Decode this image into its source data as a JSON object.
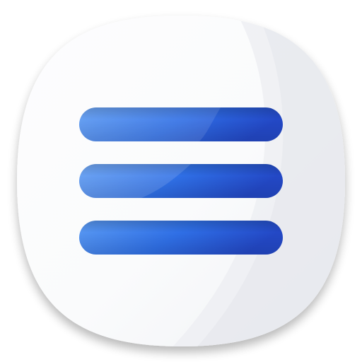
{
  "app_icon": {
    "icon_name": "hamburger-menu-icon",
    "bar_count": 3,
    "colors": {
      "tile_light": "#fdfdfe",
      "tile_mid": "#f1f2f5",
      "tile_edge": "#e3e5ea",
      "bar_light": "#5b9bf3",
      "bar_mid": "#2f6fe6",
      "bar_dark": "#2348c6",
      "shadow": "#9ea3ad"
    }
  }
}
